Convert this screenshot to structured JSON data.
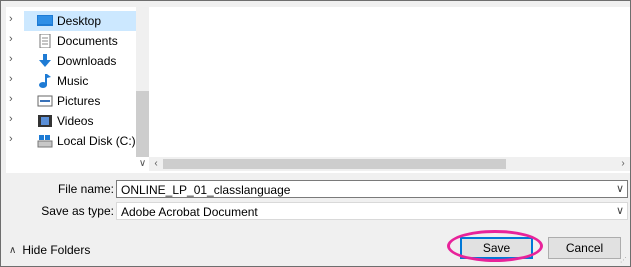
{
  "nav": {
    "items": [
      {
        "label": "Desktop",
        "icon": "desktop-icon",
        "selected": true
      },
      {
        "label": "Documents",
        "icon": "documents-icon",
        "selected": false
      },
      {
        "label": "Downloads",
        "icon": "downloads-icon",
        "selected": false
      },
      {
        "label": "Music",
        "icon": "music-icon",
        "selected": false
      },
      {
        "label": "Pictures",
        "icon": "pictures-icon",
        "selected": false
      },
      {
        "label": "Videos",
        "icon": "videos-icon",
        "selected": false
      },
      {
        "label": "Local Disk (C:)",
        "icon": "drive-icon",
        "selected": false
      }
    ]
  },
  "form": {
    "file_name_label": "File name:",
    "file_name_value": "ONLINE_LP_01_classlanguage",
    "save_type_label": "Save as type:",
    "save_type_value": "Adobe Acrobat Document"
  },
  "footer": {
    "hide_folders_label": "Hide Folders",
    "save_label": "Save",
    "cancel_label": "Cancel"
  },
  "colors": {
    "selection": "#cce8ff",
    "focus_border": "#0078d7",
    "highlight_ring": "#e8239a"
  }
}
